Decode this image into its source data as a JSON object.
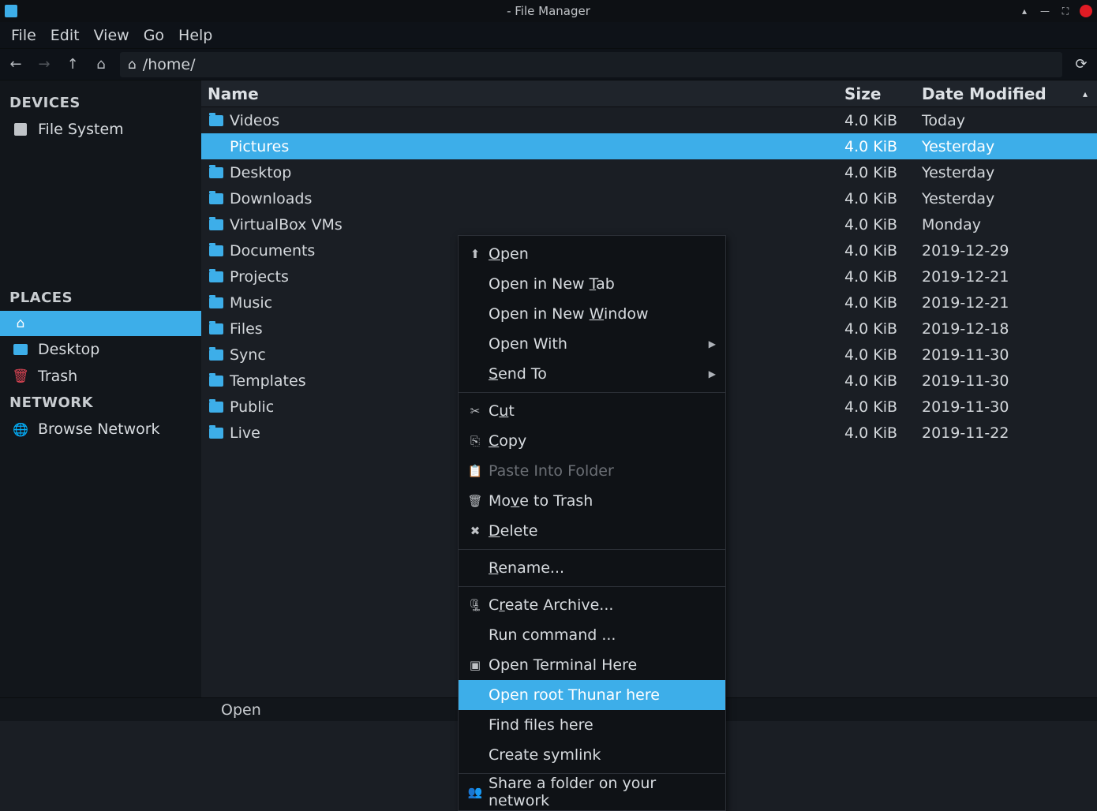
{
  "window": {
    "title": "- File Manager"
  },
  "menubar": [
    "File",
    "Edit",
    "View",
    "Go",
    "Help"
  ],
  "path": "/home/",
  "sidebar": {
    "devices_header": "DEVICES",
    "devices": [
      {
        "label": "File System"
      }
    ],
    "places_header": "PLACES",
    "places": [
      {
        "label": "",
        "is_home": true
      },
      {
        "label": "Desktop"
      },
      {
        "label": "Trash"
      }
    ],
    "network_header": "NETWORK",
    "network": [
      {
        "label": "Browse Network"
      }
    ]
  },
  "columns": {
    "name": "Name",
    "size": "Size",
    "date": "Date Modified"
  },
  "files": [
    {
      "name": "Videos",
      "size": "4.0 KiB",
      "date": "Today"
    },
    {
      "name": "Pictures",
      "size": "4.0 KiB",
      "date": "Yesterday",
      "selected": true
    },
    {
      "name": "Desktop",
      "size": "4.0 KiB",
      "date": "Yesterday"
    },
    {
      "name": "Downloads",
      "size": "4.0 KiB",
      "date": "Yesterday"
    },
    {
      "name": "VirtualBox VMs",
      "size": "4.0 KiB",
      "date": "Monday"
    },
    {
      "name": "Documents",
      "size": "4.0 KiB",
      "date": "2019-12-29"
    },
    {
      "name": "Projects",
      "size": "4.0 KiB",
      "date": "2019-12-21"
    },
    {
      "name": "Music",
      "size": "4.0 KiB",
      "date": "2019-12-21"
    },
    {
      "name": "Files",
      "size": "4.0 KiB",
      "date": "2019-12-18"
    },
    {
      "name": "Sync",
      "size": "4.0 KiB",
      "date": "2019-11-30"
    },
    {
      "name": "Templates",
      "size": "4.0 KiB",
      "date": "2019-11-30"
    },
    {
      "name": "Public",
      "size": "4.0 KiB",
      "date": "2019-11-30"
    },
    {
      "name": "Live",
      "size": "4.0 KiB",
      "date": "2019-11-22"
    }
  ],
  "context_menu": [
    {
      "label": "Open",
      "icon": "⬆",
      "mn": "O"
    },
    {
      "label": "Open in New Tab",
      "mn": "T"
    },
    {
      "label": "Open in New Window",
      "mn": "W"
    },
    {
      "label": "Open With",
      "submenu": true
    },
    {
      "label": "Send To",
      "submenu": true,
      "mn": "S"
    },
    {
      "sep": true
    },
    {
      "label": "Cut",
      "icon": "✂",
      "mn": "u"
    },
    {
      "label": "Copy",
      "icon": "⎘",
      "mn": "C"
    },
    {
      "label": "Paste Into Folder",
      "icon": "📋",
      "disabled": true
    },
    {
      "label": "Move to Trash",
      "icon": "🗑",
      "mn": "v"
    },
    {
      "label": "Delete",
      "icon": "✖",
      "mn": "D"
    },
    {
      "sep": true
    },
    {
      "label": "Rename...",
      "mn": "R"
    },
    {
      "sep": true
    },
    {
      "label": "Create Archive...",
      "icon": "🗜",
      "mn": "r"
    },
    {
      "label": "Run command ..."
    },
    {
      "label": "Open Terminal Here",
      "icon": "▣"
    },
    {
      "label": "Open root Thunar here",
      "hover": true
    },
    {
      "label": "Find files here"
    },
    {
      "label": "Create symlink"
    },
    {
      "sep": true
    },
    {
      "label": "Share a folder on your network",
      "icon": "👥"
    }
  ],
  "statusbar": "Open"
}
